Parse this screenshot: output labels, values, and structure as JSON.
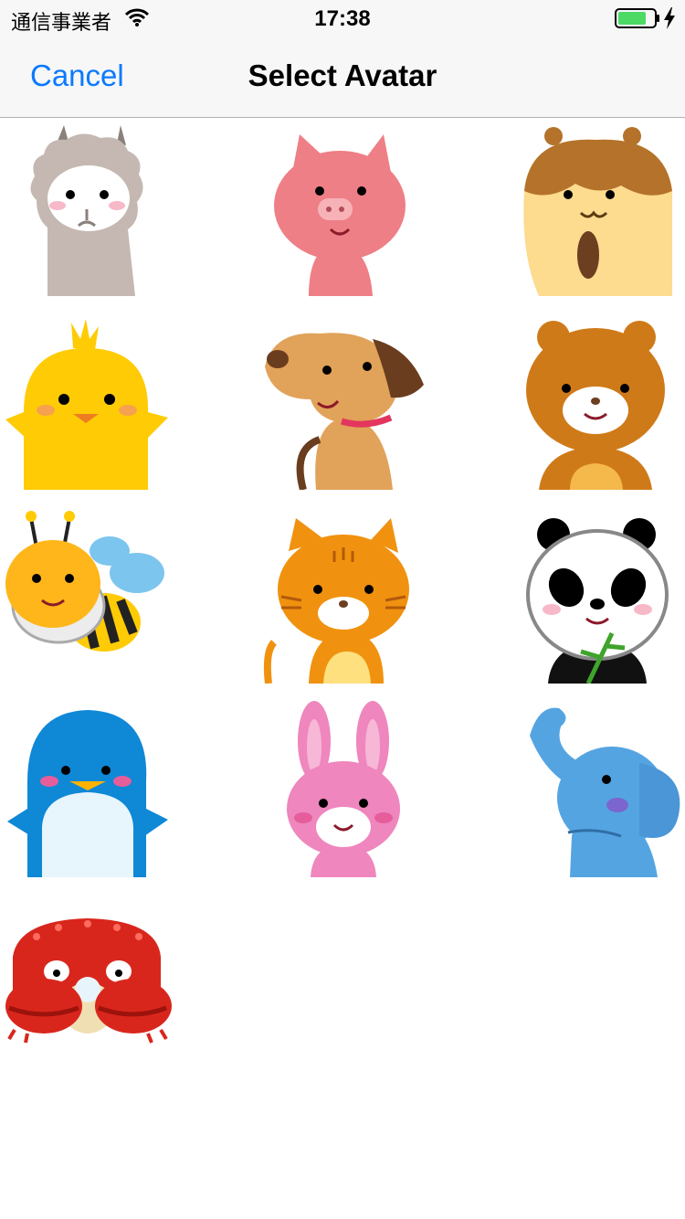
{
  "status_bar": {
    "carrier": "通信事業者",
    "time": "17:38",
    "battery_color": "#4cd964"
  },
  "nav": {
    "cancel_label": "Cancel",
    "title": "Select Avatar",
    "accent_color": "#0a7aff"
  },
  "avatars": [
    {
      "name": "alpaca"
    },
    {
      "name": "pig"
    },
    {
      "name": "hamster"
    },
    {
      "name": "chick"
    },
    {
      "name": "dog"
    },
    {
      "name": "bear"
    },
    {
      "name": "bee"
    },
    {
      "name": "cat"
    },
    {
      "name": "panda"
    },
    {
      "name": "penguin"
    },
    {
      "name": "rabbit"
    },
    {
      "name": "elephant"
    },
    {
      "name": "crab"
    }
  ]
}
